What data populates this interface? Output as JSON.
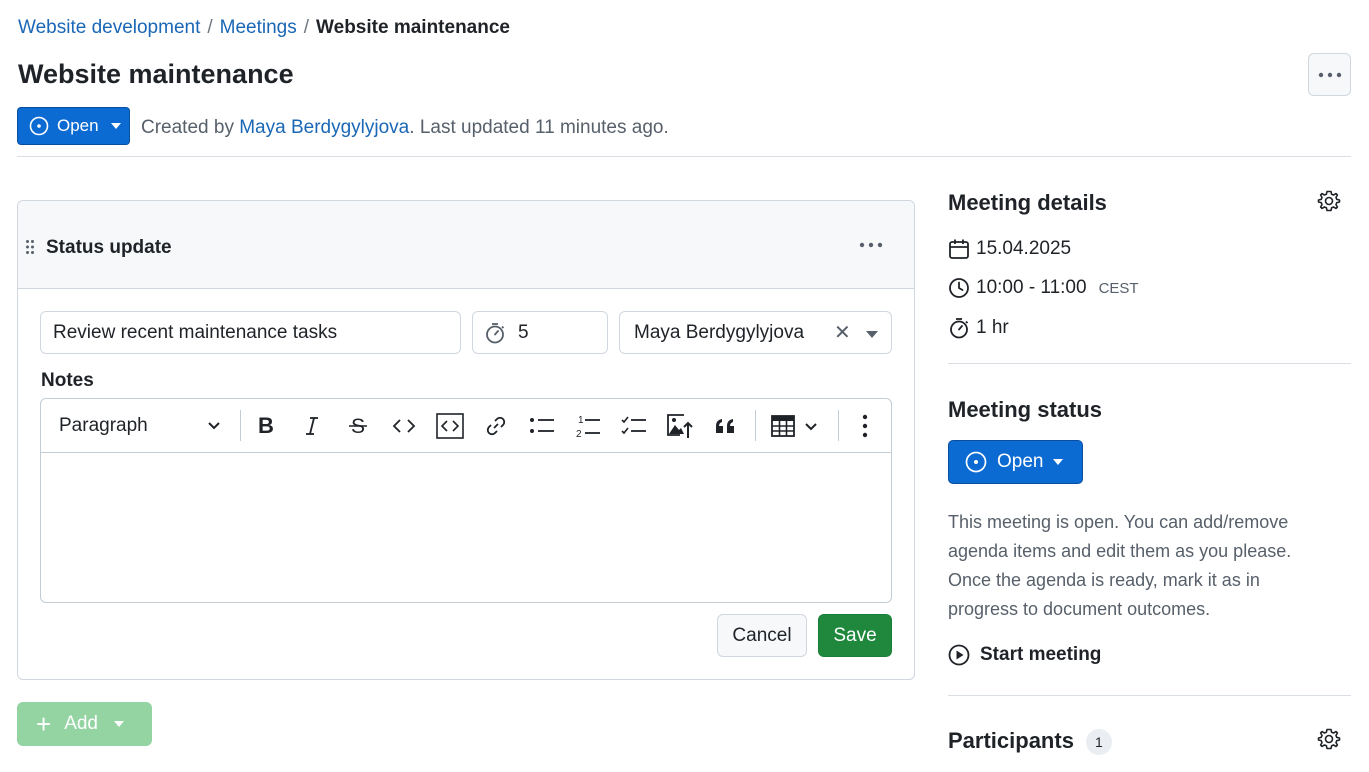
{
  "breadcrumb": {
    "items": [
      "Website development",
      "Meetings"
    ],
    "separator": "/",
    "current": "Website maintenance"
  },
  "page": {
    "title": "Website maintenance"
  },
  "header": {
    "status_label": "Open",
    "created_by_prefix": "Created by ",
    "created_by_user": "Maya Berdygylyjova",
    "updated_text": ". Last updated 11 minutes ago."
  },
  "agenda_item": {
    "title": "Status update",
    "title_input_value": "Review recent maintenance tasks",
    "duration_value": "5",
    "responsible_user": "Maya Berdygylyjova",
    "notes_label": "Notes",
    "editor": {
      "block_style": "Paragraph",
      "tools": [
        "bold",
        "italic",
        "strikethrough",
        "code",
        "code-block",
        "link",
        "bulleted-list",
        "numbered-list",
        "todo-list",
        "insert-image",
        "block-quote",
        "insert-table",
        "more"
      ]
    },
    "cancel_label": "Cancel",
    "save_label": "Save"
  },
  "add_button": {
    "label": "Add"
  },
  "sidebar": {
    "details_heading": "Meeting details",
    "date": "15.04.2025",
    "time": "10:00 - 11:00",
    "timezone": "CEST",
    "duration": "1 hr",
    "status_heading": "Meeting status",
    "status_label": "Open",
    "status_description": "This meeting is open. You can add/remove agenda items and edit them as you please. Once the agenda is ready, mark it as in progress to document outcomes.",
    "start_meeting_label": "Start meeting",
    "participants_heading": "Participants",
    "participants_count": "1"
  },
  "colors": {
    "primary": "#0b6bd3",
    "success": "#1f883d",
    "success_disabled": "#94d3a2",
    "link": "#1a67b5"
  }
}
